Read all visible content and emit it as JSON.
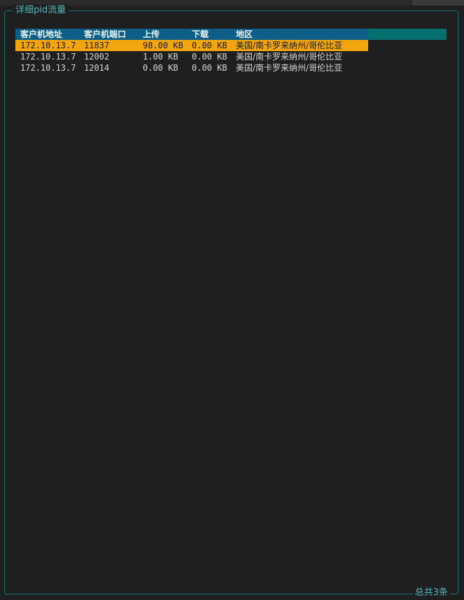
{
  "panel": {
    "title": "详细pid流量",
    "footer": "总共3条"
  },
  "table": {
    "columns": [
      "客户机地址",
      "客户机端口",
      "上传",
      "下载",
      "地区"
    ],
    "rows": [
      {
        "address": "172.10.13.7",
        "port": "11837",
        "upload": "98.00 KB",
        "download": "0.00 KB",
        "region": "美国/南卡罗来纳州/哥伦比亚",
        "selected": true
      },
      {
        "address": "172.10.13.7",
        "port": "12002",
        "upload": "1.00 KB",
        "download": "0.00 KB",
        "region": "美国/南卡罗来纳州/哥伦比亚",
        "selected": false
      },
      {
        "address": "172.10.13.7",
        "port": "12014",
        "upload": "0.00 KB",
        "download": "0.00 KB",
        "region": "美国/南卡罗来纳州/哥伦比亚",
        "selected": false
      }
    ]
  },
  "colors": {
    "border": "#1b6f73",
    "title_text": "#4fb6ba",
    "header_bg": "#0d5f8a",
    "header_extension_bg": "#05706f",
    "selected_row_bg": "#f2a50c",
    "background": "#1f1f1f"
  }
}
